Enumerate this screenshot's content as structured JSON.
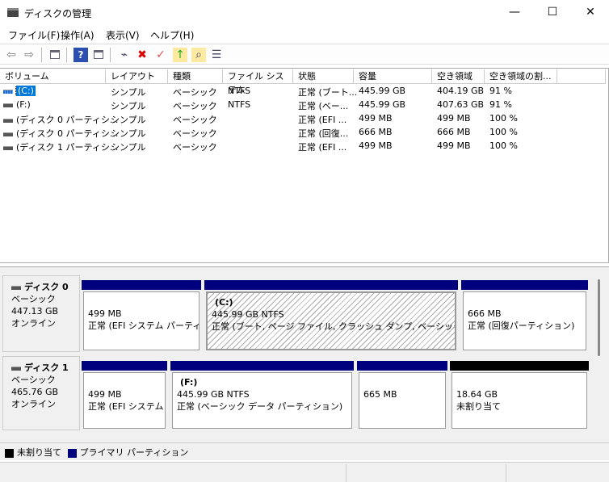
{
  "window": {
    "title": "ディスクの管理",
    "minimize": "—",
    "maximize": "☐",
    "close": "✕"
  },
  "menu": [
    "ファイル(F)",
    "操作(A)",
    "表示(V)",
    "ヘルプ(H)"
  ],
  "toolbar": {
    "back": "⇦",
    "forward": "⇨",
    "help": "?",
    "delete": "✖"
  },
  "list": {
    "columns": [
      "ボリューム",
      "レイアウト",
      "種類",
      "ファイル システム",
      "状態",
      "容量",
      "空き領域",
      "空き領域の割..."
    ],
    "rows": [
      [
        "(C:)",
        "シンプル",
        "ベーシック",
        "NTFS",
        "正常 (ブート...",
        "445.99 GB",
        "404.19 GB",
        "91 %"
      ],
      [
        "(F:)",
        "シンプル",
        "ベーシック",
        "NTFS",
        "正常 (ベー...",
        "445.99 GB",
        "407.63 GB",
        "91 %"
      ],
      [
        "(ディスク 0 パーティシ...",
        "シンプル",
        "ベーシック",
        "",
        "正常 (EFI ...",
        "499 MB",
        "499 MB",
        "100 %"
      ],
      [
        "(ディスク 0 パーティシ...",
        "シンプル",
        "ベーシック",
        "",
        "正常 (回復...",
        "666 MB",
        "666 MB",
        "100 %"
      ],
      [
        "(ディスク 1 パーティシ...",
        "シンプル",
        "ベーシック",
        "",
        "正常 (EFI ...",
        "499 MB",
        "499 MB",
        "100 %"
      ]
    ]
  },
  "disks": [
    {
      "name": "ディスク 0",
      "type": "ベーシック",
      "size": "447.13 GB",
      "status": "オンライン",
      "partitions": [
        {
          "label": "",
          "size": "499 MB",
          "status": "正常 (EFI システム パーティション)"
        },
        {
          "label": "(C:)",
          "size": "445.99 GB NTFS",
          "status": "正常 (ブート, ページ ファイル, クラッシュ ダンプ, ベーシック データ パーティション)"
        },
        {
          "label": "",
          "size": "666 MB",
          "status": "正常 (回復パーティション)"
        }
      ]
    },
    {
      "name": "ディスク 1",
      "type": "ベーシック",
      "size": "465.76 GB",
      "status": "オンライン",
      "partitions": [
        {
          "label": "",
          "size": "499 MB",
          "status": "正常 (EFI システム パーティション)"
        },
        {
          "label": "(F:)",
          "size": "445.99 GB NTFS",
          "status": "正常 (ベーシック データ パーティション)"
        },
        {
          "label": "",
          "size": "665 MB",
          "status": ""
        },
        {
          "label": "",
          "size": "18.64 GB",
          "status": "未割り当て"
        }
      ]
    }
  ],
  "legend": {
    "unallocated": "未割り当て",
    "primary": "プライマリ パーティション"
  },
  "colors": {
    "primary": "#00007f",
    "unallocated": "#000000"
  }
}
